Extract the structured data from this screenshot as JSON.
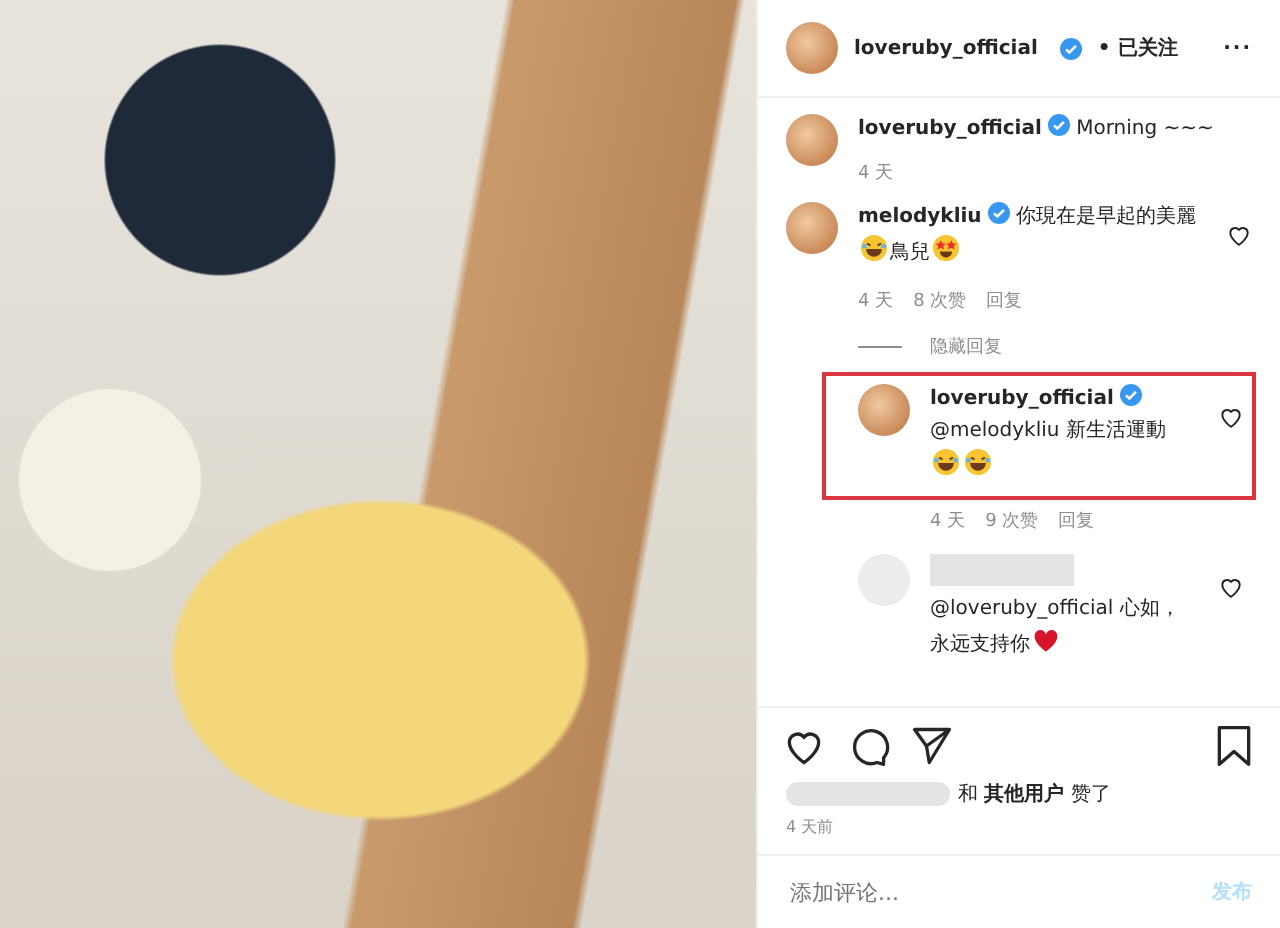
{
  "post": {
    "author": "loveruby_official",
    "verified": true,
    "follow_status": "• 已关注",
    "more": "···"
  },
  "caption": {
    "author": "loveruby_official",
    "verified": true,
    "text": "Morning ~~~",
    "time": "4 天"
  },
  "comments": [
    {
      "kind": "comment",
      "author": "melodykliu",
      "verified": true,
      "parts": [
        {
          "kind": "text",
          "text": "你現在是早起的美麗"
        },
        {
          "kind": "laughing-emoji"
        },
        {
          "kind": "text",
          "text": "鳥兒"
        },
        {
          "kind": "star-eyes-emoji"
        }
      ],
      "time": "4 天",
      "likes": "8 次赞",
      "reply": "回复",
      "liked": false
    },
    {
      "kind": "toggle",
      "text": "隐藏回复"
    },
    {
      "kind": "reply",
      "author": "loveruby_official",
      "verified": true,
      "parts": [
        {
          "kind": "text",
          "text": "@melodykliu 新生活運動"
        },
        {
          "kind": "break"
        },
        {
          "kind": "laughing-emoji"
        },
        {
          "kind": "laughing-emoji"
        }
      ],
      "time": "4 天",
      "likes": "9 次赞",
      "reply": "回复",
      "liked": false,
      "highlighted": true
    },
    {
      "kind": "reply",
      "parts": [
        {
          "kind": "text",
          "text": "@loveruby_official 心如，永远支持你"
        },
        {
          "kind": "heart-emoji"
        }
      ],
      "liked": false,
      "blurred": true
    }
  ],
  "likes": {
    "joiner": "和",
    "others": "其他用户",
    "suffix": "赞了",
    "time": "4 天前"
  },
  "add_comment": {
    "placeholder": "添加评论...",
    "post_button": "发布",
    "post_enabled": false
  }
}
